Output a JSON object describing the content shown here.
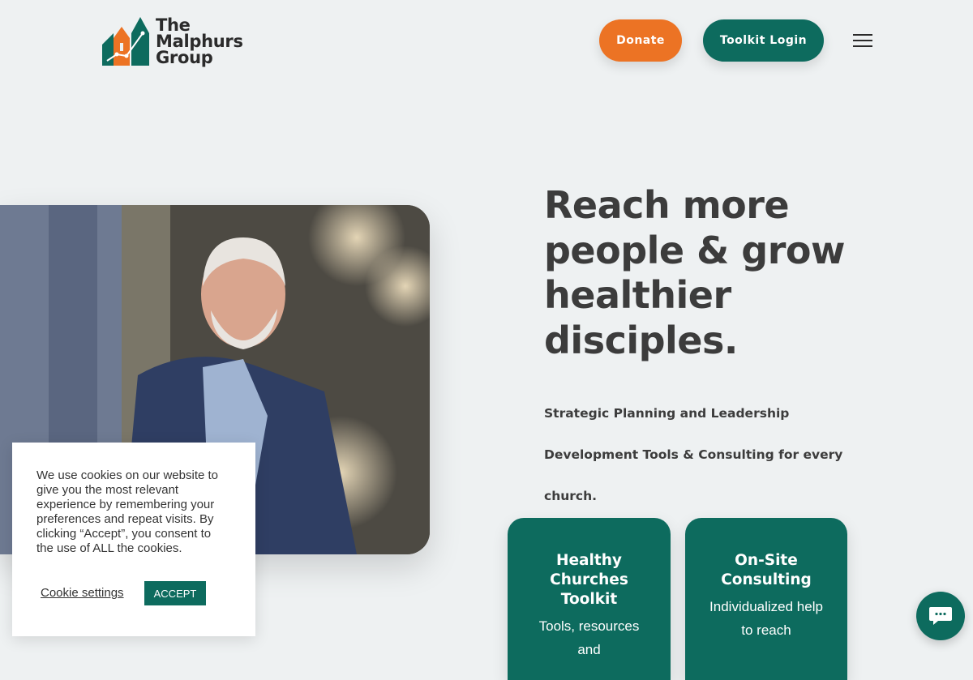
{
  "header": {
    "logo": {
      "line1": "The",
      "line2": "Malphurs",
      "line3": "Group"
    },
    "donate_label": "Donate",
    "toolkit_login_label": "Toolkit Login",
    "menu_icon": "hamburger-menu-icon"
  },
  "hero": {
    "headline": "Reach more people & grow healthier disciples.",
    "subline": "Strategic Planning and Leadership Development Tools & Consulting for every church.",
    "image": "person-photo"
  },
  "cards": [
    {
      "title": "Healthy Churches Toolkit",
      "description": "Tools, resources and"
    },
    {
      "title": "On-Site Consulting",
      "description": "Individualized help to reach"
    }
  ],
  "cookie_banner": {
    "text": "We use cookies on our website to give you the most relevant experience by remembering your preferences and repeat visits. By clicking “Accept”, you consent to the use of ALL the cookies.",
    "settings_label": "Cookie settings",
    "accept_label": "ACCEPT"
  },
  "chat": {
    "icon": "chat-bubble-icon"
  },
  "colors": {
    "orange": "#ec7324",
    "teal": "#0d6b5e",
    "background": "#eef1f2",
    "text": "#3c3c3c"
  }
}
